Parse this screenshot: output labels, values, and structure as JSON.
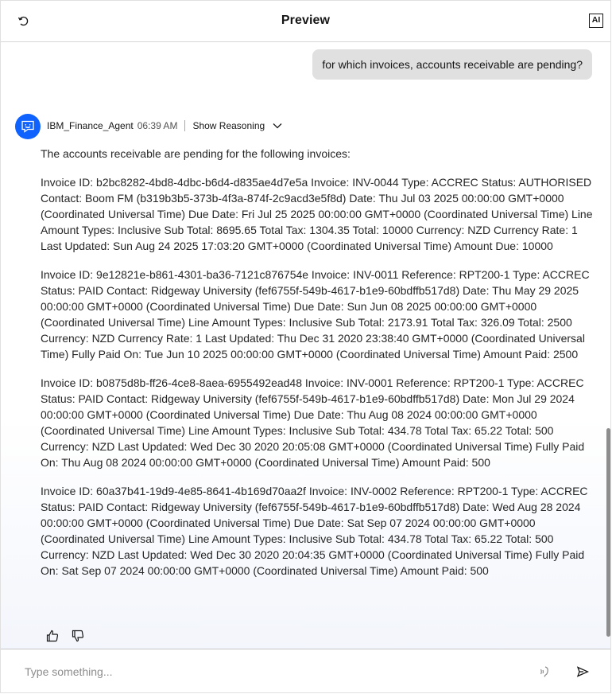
{
  "header": {
    "title": "Preview",
    "ai_badge": "AI",
    "restart_icon": "restart-icon"
  },
  "user_message": "for which invoices, accounts receivable are pending?",
  "agent": {
    "name": "IBM_Finance_Agent",
    "time": "06:39 AM",
    "show_reasoning_label": "Show Reasoning",
    "avatar_icon": "chat-bot-icon",
    "paragraphs": [
      "The accounts receivable are pending for the following invoices:",
      "Invoice ID: b2bc8282-4bd8-4dbc-b6d4-d835ae4d7e5a Invoice: INV-0044 Type: ACCREC Status: AUTHORISED Contact: Boom FM (b319b3b5-373b-4f3a-874f-2c9acd3e5f8d) Date: Thu Jul 03 2025 00:00:00 GMT+0000 (Coordinated Universal Time) Due Date: Fri Jul 25 2025 00:00:00 GMT+0000 (Coordinated Universal Time) Line Amount Types: Inclusive Sub Total: 8695.65 Total Tax: 1304.35 Total: 10000 Currency: NZD Currency Rate: 1 Last Updated: Sun Aug 24 2025 17:03:20 GMT+0000 (Coordinated Universal Time) Amount Due: 10000",
      "Invoice ID: 9e12821e-b861-4301-ba36-7121c876754e Invoice: INV-0011 Reference: RPT200-1 Type: ACCREC Status: PAID Contact: Ridgeway University (fef6755f-549b-4617-b1e9-60bdffb517d8) Date: Thu May 29 2025 00:00:00 GMT+0000 (Coordinated Universal Time) Due Date: Sun Jun 08 2025 00:00:00 GMT+0000 (Coordinated Universal Time) Line Amount Types: Inclusive Sub Total: 2173.91 Total Tax: 326.09 Total: 2500 Currency: NZD Currency Rate: 1 Last Updated: Thu Dec 31 2020 23:38:40 GMT+0000 (Coordinated Universal Time) Fully Paid On: Tue Jun 10 2025 00:00:00 GMT+0000 (Coordinated Universal Time) Amount Paid: 2500",
      "Invoice ID: b0875d8b-ff26-4ce8-8aea-6955492ead48 Invoice: INV-0001 Reference: RPT200-1 Type: ACCREC Status: PAID Contact: Ridgeway University (fef6755f-549b-4617-b1e9-60bdffb517d8) Date: Mon Jul 29 2024 00:00:00 GMT+0000 (Coordinated Universal Time) Due Date: Thu Aug 08 2024 00:00:00 GMT+0000 (Coordinated Universal Time) Line Amount Types: Inclusive Sub Total: 434.78 Total Tax: 65.22 Total: 500 Currency: NZD Last Updated: Wed Dec 30 2020 20:05:08 GMT+0000 (Coordinated Universal Time) Fully Paid On: Thu Aug 08 2024 00:00:00 GMT+0000 (Coordinated Universal Time) Amount Paid: 500",
      "Invoice ID: 60a37b41-19d9-4e85-8641-4b169d70aa2f Invoice: INV-0002 Reference: RPT200-1 Type: ACCREC Status: PAID Contact: Ridgeway University (fef6755f-549b-4617-b1e9-60bdffb517d8) Date: Wed Aug 28 2024 00:00:00 GMT+0000 (Coordinated Universal Time) Due Date: Sat Sep 07 2024 00:00:00 GMT+0000 (Coordinated Universal Time) Line Amount Types: Inclusive Sub Total: 434.78 Total Tax: 65.22 Total: 500 Currency: NZD Last Updated: Wed Dec 30 2020 20:04:35 GMT+0000 (Coordinated Universal Time) Fully Paid On: Sat Sep 07 2024 00:00:00 GMT+0000 (Coordinated Universal Time) Amount Paid: 500"
    ]
  },
  "feedback": {
    "thumbs_up_icon": "thumbs-up-icon",
    "thumbs_down_icon": "thumbs-down-icon"
  },
  "input": {
    "placeholder": "Type something...",
    "value": "",
    "voice_icon": "voice-icon",
    "send_icon": "send-icon"
  },
  "colors": {
    "accent": "#0f62fe",
    "user_bubble": "#e0e0e0"
  }
}
